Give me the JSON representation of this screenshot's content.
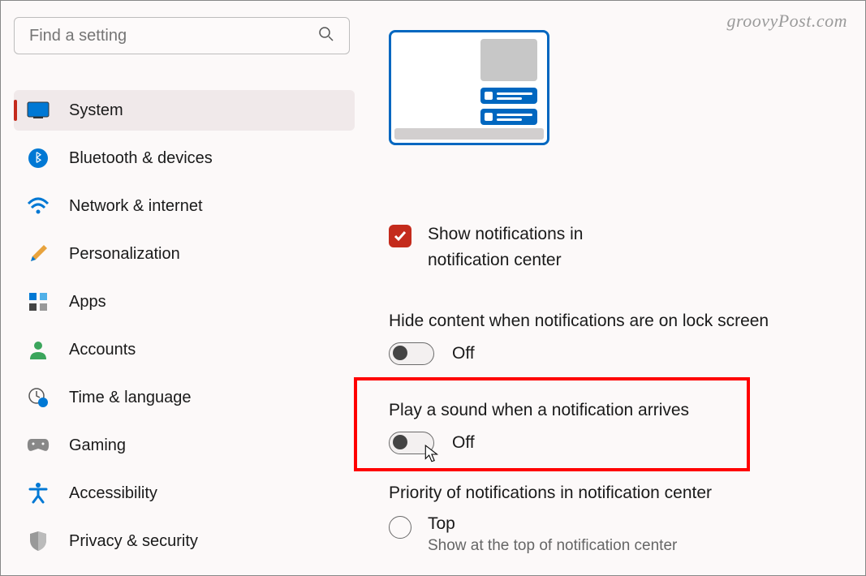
{
  "watermark": "groovyPost.com",
  "search": {
    "placeholder": "Find a setting"
  },
  "sidebar": {
    "items": [
      {
        "label": "System",
        "icon": "system",
        "active": true
      },
      {
        "label": "Bluetooth & devices",
        "icon": "bluetooth",
        "active": false
      },
      {
        "label": "Network & internet",
        "icon": "wifi",
        "active": false
      },
      {
        "label": "Personalization",
        "icon": "brush",
        "active": false
      },
      {
        "label": "Apps",
        "icon": "apps",
        "active": false
      },
      {
        "label": "Accounts",
        "icon": "person",
        "active": false
      },
      {
        "label": "Time & language",
        "icon": "clock",
        "active": false
      },
      {
        "label": "Gaming",
        "icon": "gamepad",
        "active": false
      },
      {
        "label": "Accessibility",
        "icon": "accessibility",
        "active": false
      },
      {
        "label": "Privacy & security",
        "icon": "shield",
        "active": false
      }
    ]
  },
  "main": {
    "show_notifications": {
      "label": "Show notifications in notification center",
      "checked": true
    },
    "hide_content": {
      "title": "Hide content when notifications are on lock screen",
      "state": "Off"
    },
    "play_sound": {
      "title": "Play a sound when a notification arrives",
      "state": "Off"
    },
    "priority": {
      "title": "Priority of notifications in notification center",
      "option_label": "Top",
      "option_sub": "Show at the top of notification center"
    }
  }
}
